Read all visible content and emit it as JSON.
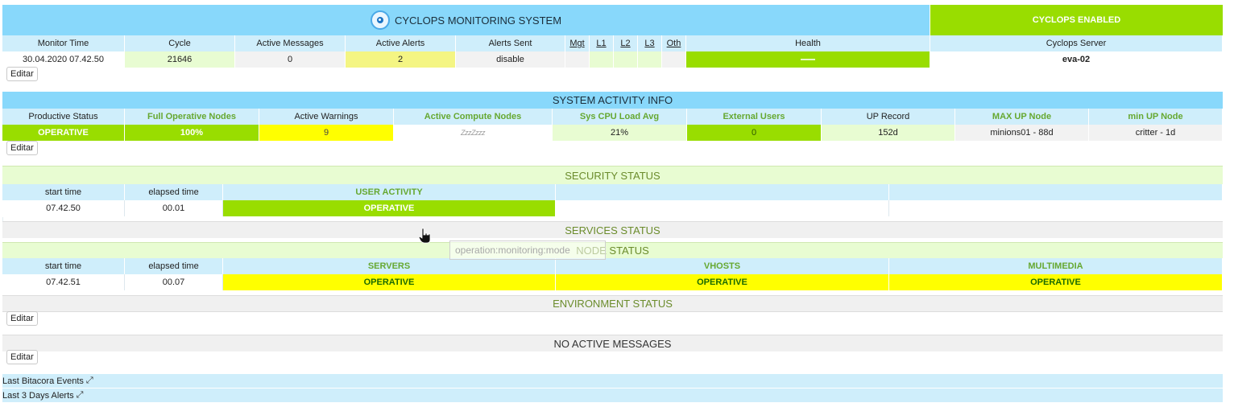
{
  "header": {
    "title": "CYCLOPS MONITORING SYSTEM",
    "status_label": "CYCLOPS ENABLED",
    "columns": [
      "Monitor Time",
      "Cycle",
      "Active Messages",
      "Active Alerts",
      "Alerts Sent",
      "Mgt",
      "L1",
      "L2",
      "L3",
      "Oth",
      "Health",
      "Cyclops Server"
    ],
    "values": {
      "monitor_time": "30.04.2020 07.42.50",
      "cycle": "21646",
      "active_messages": "0",
      "active_alerts": "2",
      "alerts_sent": "disable",
      "mgt": "",
      "l1": "",
      "l2": "",
      "l3": "",
      "oth": "",
      "health": "",
      "server": "eva-02"
    }
  },
  "edit_label": "Editar",
  "activity": {
    "title": "SYSTEM ACTIVITY INFO",
    "columns": [
      "Productive Status",
      "Full Operative Nodes",
      "Active Warnings",
      "Active Compute Nodes",
      "Sys CPU Load Avg",
      "External Users",
      "UP Record",
      "MAX UP Node",
      "min UP Node"
    ],
    "values": [
      "OPERATIVE",
      "100%",
      "9",
      "ZzzZzzz",
      "21%",
      "0",
      "152d",
      "minions01 - 88d",
      "critter - 1d"
    ]
  },
  "security": {
    "title": "SECURITY STATUS",
    "columns": [
      "start time",
      "elapsed time",
      "USER ACTIVITY"
    ],
    "values": [
      "07.42.50",
      "00.01",
      "OPERATIVE"
    ]
  },
  "services": {
    "title": "SERVICES STATUS"
  },
  "tooltip": "operation:monitoring:mode",
  "node": {
    "title": "NODE STATUS",
    "columns": [
      "start time",
      "elapsed time",
      "SERVERS",
      "VHOSTS",
      "MULTIMEDIA"
    ],
    "values": [
      "07.42.51",
      "00.07",
      "OPERATIVE",
      "OPERATIVE",
      "OPERATIVE"
    ]
  },
  "environment": {
    "title": "ENVIRONMENT STATUS"
  },
  "messages": {
    "title": "NO ACTIVE MESSAGES"
  },
  "links": {
    "bitacora": "Last Bitacora Events",
    "alerts": "Last 3 Days Alerts"
  },
  "colors": {
    "title_blue": "#88d8fb",
    "header_blue": "#cfeefb",
    "enabled_green": "#99dd00",
    "operative_yellow": "#ffff00",
    "alert_yellow": "#f4f583"
  }
}
